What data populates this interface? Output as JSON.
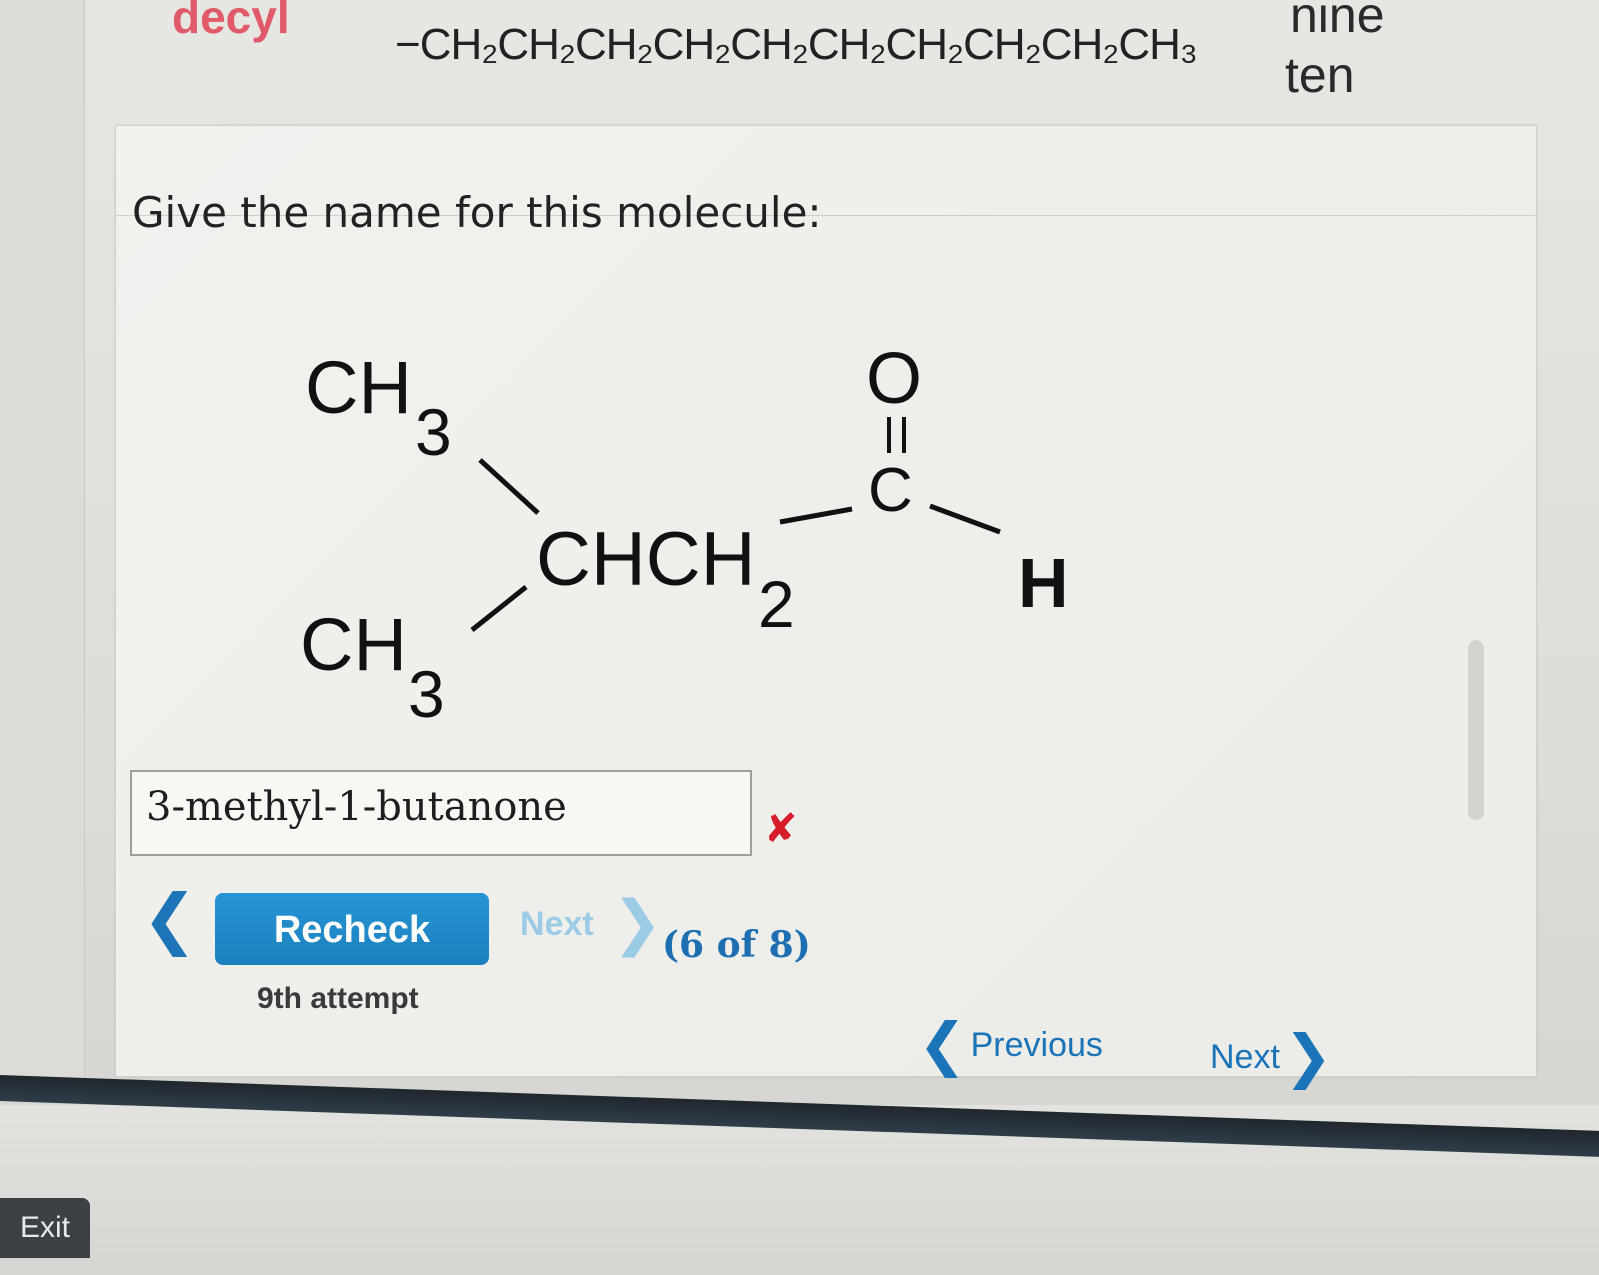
{
  "reference_row": {
    "name": "decyl",
    "formula": "−CH₂CH₂CH₂CH₂CH₂CH₂CH₂CH₂CH₂CH₃",
    "number_word_above": "nine",
    "number_word": "ten"
  },
  "question": {
    "prompt": "Give the name for this molecule:"
  },
  "molecule_labels": {
    "upper_methyl": "CH",
    "upper_methyl_sub": "3",
    "lower_methyl": "CH",
    "lower_methyl_sub": "3",
    "chain": "CHCH",
    "chain_sub": "2",
    "carbonyl_o": "O",
    "carbonyl_c": "C",
    "aldehyde_h": "H"
  },
  "answer": {
    "value": "3-methyl-1-butanone",
    "status": "incorrect",
    "status_glyph": "✘"
  },
  "controls": {
    "back_chevron": "❮",
    "recheck_label": "Recheck",
    "attempt_text": "9th attempt",
    "next_label": "Next",
    "next_chevron": "❯",
    "position_text": "(6 of 8)"
  },
  "page_nav": {
    "previous_chevron": "❮",
    "previous_label": "Previous",
    "next_label": "Next",
    "next_chevron": "❯"
  },
  "footer": {
    "exit_label": "Exit"
  },
  "colors": {
    "accent": "#1b80be",
    "error": "#d71d2a",
    "alkyl_name": "#e05a69"
  }
}
